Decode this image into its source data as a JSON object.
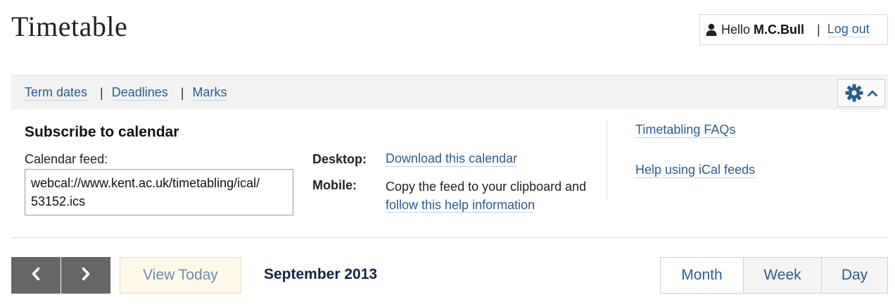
{
  "page": {
    "title": "Timetable"
  },
  "user": {
    "greeting": "Hello",
    "name": "M.C.Bull",
    "separator": "|",
    "logout_label": "Log out",
    "icon": "user-icon"
  },
  "toolbar": {
    "links": [
      {
        "label": "Term dates"
      },
      {
        "label": "Deadlines"
      },
      {
        "label": "Marks"
      }
    ],
    "separator": "|",
    "settings_icon": "gear-icon",
    "toggle_icon": "chevron-up-icon"
  },
  "subscribe": {
    "title": "Subscribe to calendar",
    "feed_label": "Calendar feed:",
    "feed_value_line1": "webcal://www.kent.ac.uk/timetabling/ical/",
    "feed_value_line2": "53152.ics",
    "desktop_label": "Desktop:",
    "desktop_link": "Download this calendar",
    "mobile_label": "Mobile:",
    "mobile_text": "Copy the feed to your clipboard and ",
    "mobile_link": "follow this help information"
  },
  "help": {
    "faq_link": "Timetabling FAQs",
    "ical_link": "Help using iCal feeds"
  },
  "calendar_nav": {
    "prev_icon": "chevron-left-icon",
    "next_icon": "chevron-right-icon",
    "today_label": "View Today",
    "current_month": "September 2013",
    "views": [
      {
        "label": "Month",
        "active": true
      },
      {
        "label": "Week",
        "active": false
      },
      {
        "label": "Day",
        "active": false
      }
    ]
  },
  "colors": {
    "link": "#2a5d8f",
    "arrow_bg": "#666666",
    "today_bg": "#fdf8e8",
    "month_label": "#142542"
  }
}
